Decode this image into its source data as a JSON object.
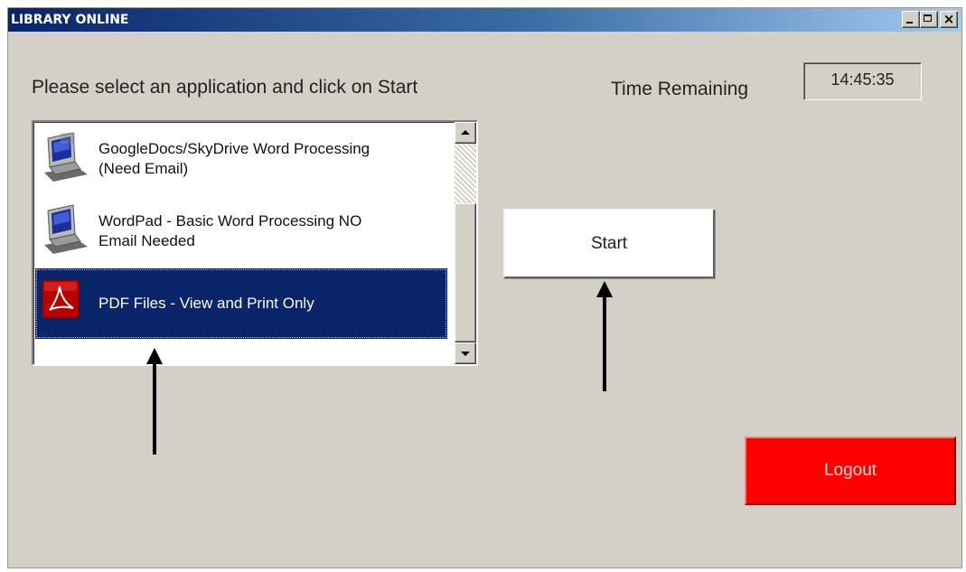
{
  "window": {
    "title": "LIBRARY ONLINE",
    "controls": [
      "minimize-icon",
      "maximize-icon",
      "close-icon"
    ],
    "close_glyph": "×"
  },
  "main": {
    "prompt": "Please select an application and click on Start",
    "time_label": "Time Remaining",
    "time_value": "14:45:35"
  },
  "app_list": {
    "items": [
      {
        "label_line1": "GoogleDocs/SkyDrive Word Processing",
        "label_line2": "(Need Email)",
        "icon": "computer-icon",
        "selected": false
      },
      {
        "label_line1": "WordPad - Basic Word Processing NO",
        "label_line2": "Email Needed",
        "icon": "computer-icon",
        "selected": false
      },
      {
        "label_line1": "PDF Files - View and Print Only",
        "label_line2": "",
        "icon": "pdf-icon",
        "selected": true
      }
    ]
  },
  "buttons": {
    "start_label": "Start",
    "logout_label": "Logout"
  },
  "colors": {
    "selection": "#0a246a",
    "logout_bg": "#ff0000",
    "window_bg": "#d4d0c8"
  },
  "annotations": [
    "arrow-up-icon",
    "arrow-up-icon"
  ]
}
